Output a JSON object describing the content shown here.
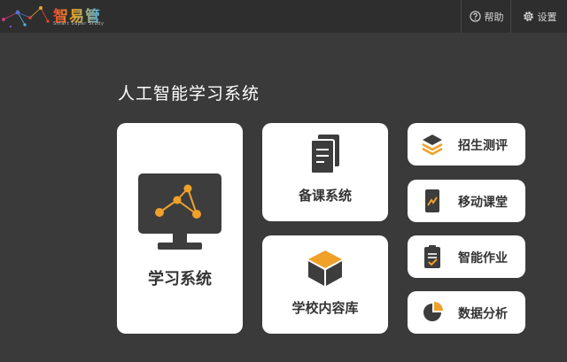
{
  "header": {
    "logo_text": "智易管",
    "logo_subtitle": "Smart Super Study",
    "help_label": "帮助",
    "settings_label": "设置"
  },
  "page_title": "人工智能学习系统",
  "cards": {
    "learning_system": "学习系统",
    "lesson_prep": "备课系统",
    "school_library": "学校内容库",
    "admission_test": "招生测评",
    "mobile_classroom": "移动课堂",
    "smart_homework": "智能作业",
    "data_analysis": "数据分析"
  },
  "colors": {
    "background": "#3a3a3a",
    "topbar": "#2e2e2e",
    "accent_orange": "#f0a12a",
    "icon_dark": "#3d3d3d",
    "card": "#ffffff"
  }
}
